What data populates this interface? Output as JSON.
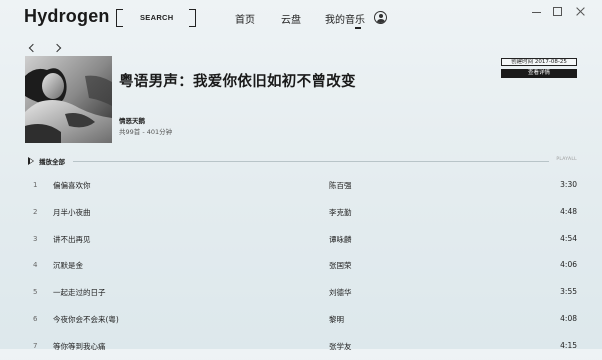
{
  "app": {
    "title": "Hydrogen"
  },
  "header": {
    "search_label": "SEARCH",
    "nav": {
      "home": "首页",
      "cloud": "云盘",
      "my_music": "我的音乐"
    }
  },
  "playlist": {
    "title": "粤语男声：我爱你依旧如初不曾改变",
    "creator": "情恶天鹅",
    "meta": "共99首 - 401分钟",
    "created": "创建时间 2017-08-25",
    "details_label": "查看详情",
    "play_all_label": "播放全部",
    "play_all_tag": "PLAYALL"
  },
  "tracks": [
    {
      "num": "1",
      "title": "偏偏喜欢你",
      "artist": "陈百强",
      "duration": "3:30"
    },
    {
      "num": "2",
      "title": "月半小夜曲",
      "artist": "李克勤",
      "duration": "4:48"
    },
    {
      "num": "3",
      "title": "讲不出再见",
      "artist": "谭咏麟",
      "duration": "4:54"
    },
    {
      "num": "4",
      "title": "沉默是金",
      "artist": "张国荣",
      "duration": "4:06"
    },
    {
      "num": "5",
      "title": "一起走过的日子",
      "artist": "刘德华",
      "duration": "3:55"
    },
    {
      "num": "6",
      "title": "今夜你会不会来(粤)",
      "artist": "黎明",
      "duration": "4:08"
    },
    {
      "num": "7",
      "title": "等你等到我心痛",
      "artist": "张学友",
      "duration": "4:15"
    }
  ],
  "icons": {
    "search": "search-bracket-icon",
    "avatar": "user-avatar-icon",
    "back": "chevron-left-icon",
    "forward": "chevron-right-icon",
    "play": "play-triangle-icon",
    "minimize": "minimize-icon",
    "maximize": "maximize-icon",
    "close": "close-icon"
  }
}
